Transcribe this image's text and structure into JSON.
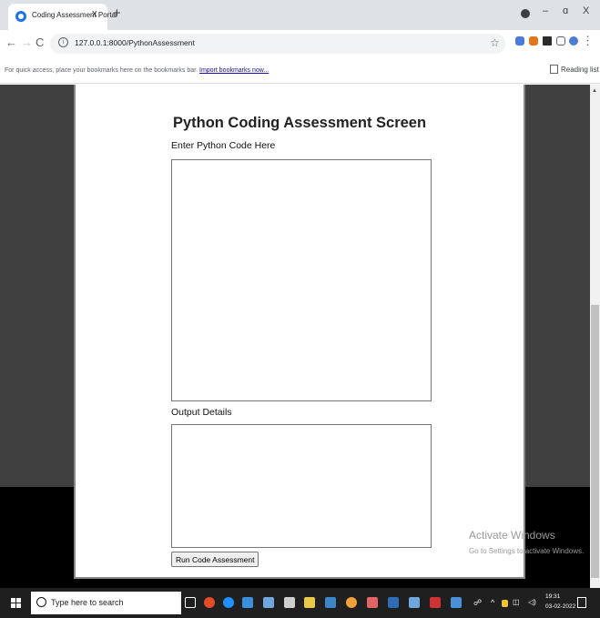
{
  "browser": {
    "tab_title": "Coding Assessment Portal",
    "tab_close": "x",
    "new_tab": "+",
    "window_controls": {
      "minimize": "–",
      "restore": "ɑ",
      "close": "X"
    },
    "nav": {
      "back": "←",
      "forward": "→",
      "reload": "C"
    },
    "omnibox_info": "i",
    "url": "127.0.0.1:8000/PythonAssessment",
    "menu": "⋮",
    "bookmarks_text": "For quick access, place your bookmarks here on the bookmarks bar.",
    "bookmarks_link": "Import bookmarks now...",
    "reading_list": "Reading list"
  },
  "page": {
    "heading": "Python Coding Assessment Screen",
    "code_label": "Enter Python Code Here",
    "code_value": "",
    "output_label": "Output Details",
    "output_value": "",
    "run_button": "Run Code Assessment"
  },
  "watermark": {
    "line1": "Activate Windows",
    "line2": "Go to Settings to activate Windows."
  },
  "taskbar": {
    "search_placeholder": "Type here to search",
    "time": "19:31",
    "date": "03-02-2022"
  },
  "colors": {
    "chrome_frame": "#dee1e6",
    "dim_overlay": "#404040",
    "taskbar": "#1f1f1f"
  }
}
